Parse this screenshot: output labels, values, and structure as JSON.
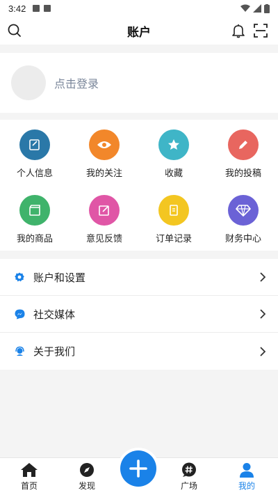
{
  "status_bar": {
    "time": "3:42"
  },
  "app_bar": {
    "title": "账户"
  },
  "login": {
    "prompt": "点击登录"
  },
  "grid": [
    {
      "label": "个人信息",
      "icon": "edit-icon",
      "color": "#2a78a8"
    },
    {
      "label": "我的关注",
      "icon": "eye-icon",
      "color": "#f2872a"
    },
    {
      "label": "收藏",
      "icon": "star-icon",
      "color": "#3fb5c7"
    },
    {
      "label": "我的投稿",
      "icon": "pencil-icon",
      "color": "#e8665f"
    },
    {
      "label": "我的商品",
      "icon": "clapperboard-icon",
      "color": "#3fb36b"
    },
    {
      "label": "意见反馈",
      "icon": "feedback-icon",
      "color": "#e056a6"
    },
    {
      "label": "订单记录",
      "icon": "receipt-icon",
      "color": "#f3c621"
    },
    {
      "label": "财务中心",
      "icon": "diamond-icon",
      "color": "#6b62d6"
    }
  ],
  "menu": [
    {
      "label": "账户和设置",
      "icon": "gear-icon"
    },
    {
      "label": "社交媒体",
      "icon": "messenger-icon"
    },
    {
      "label": "关于我们",
      "icon": "support-icon"
    }
  ],
  "tabs": [
    {
      "label": "首页",
      "icon": "home-icon"
    },
    {
      "label": "发现",
      "icon": "compass-icon"
    },
    {
      "label": "广场",
      "icon": "hashtag-chat-icon"
    },
    {
      "label": "我的",
      "icon": "user-icon"
    }
  ],
  "colors": {
    "accent": "#1a82e8",
    "inactive": "#222222"
  }
}
